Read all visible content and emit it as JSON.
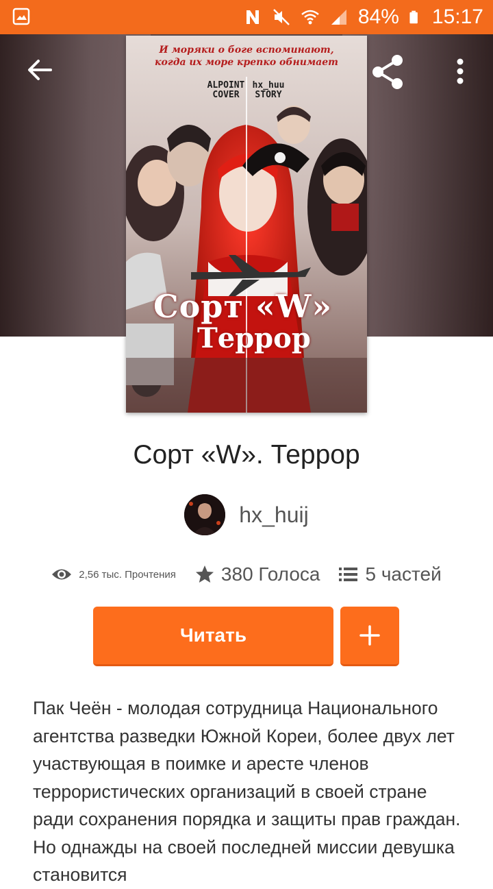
{
  "status_bar": {
    "battery_percent": "84%",
    "time": "15:17",
    "icons": [
      "gallery-icon",
      "nfc-icon",
      "mute-icon",
      "wifi-icon",
      "signal-icon",
      "battery-icon"
    ]
  },
  "header": {
    "icons": [
      "back-arrow-icon",
      "share-icon",
      "more-vert-icon"
    ]
  },
  "cover": {
    "tagline": "И моряки о боге вспоминают, когда их море крепко обнимает",
    "left_tag": "ALPOINT COVER",
    "right_tag": "hx_huu STORY",
    "title_line1": "Сорт «W»",
    "title_line2": "Террор"
  },
  "story": {
    "title": "Сорт «W». Террор",
    "author": "hx_huij"
  },
  "stats": {
    "reads": "2,56 тыс. Прочтения",
    "votes": "380 Голоса",
    "parts": "5 частей"
  },
  "actions": {
    "read_label": "Читать",
    "add_label": "+"
  },
  "description": "Пак Чеён - молодая сотрудница Национального агентства разведки Южной Кореи, более двух лет участвующая в поимке и аресте членов террористических организаций в своей стране ради сохранения порядка и защиты прав граждан. Но однажды на своей последней миссии девушка становится",
  "colors": {
    "accent": "#fd6d1c",
    "status_bar": "#f36b1c"
  }
}
